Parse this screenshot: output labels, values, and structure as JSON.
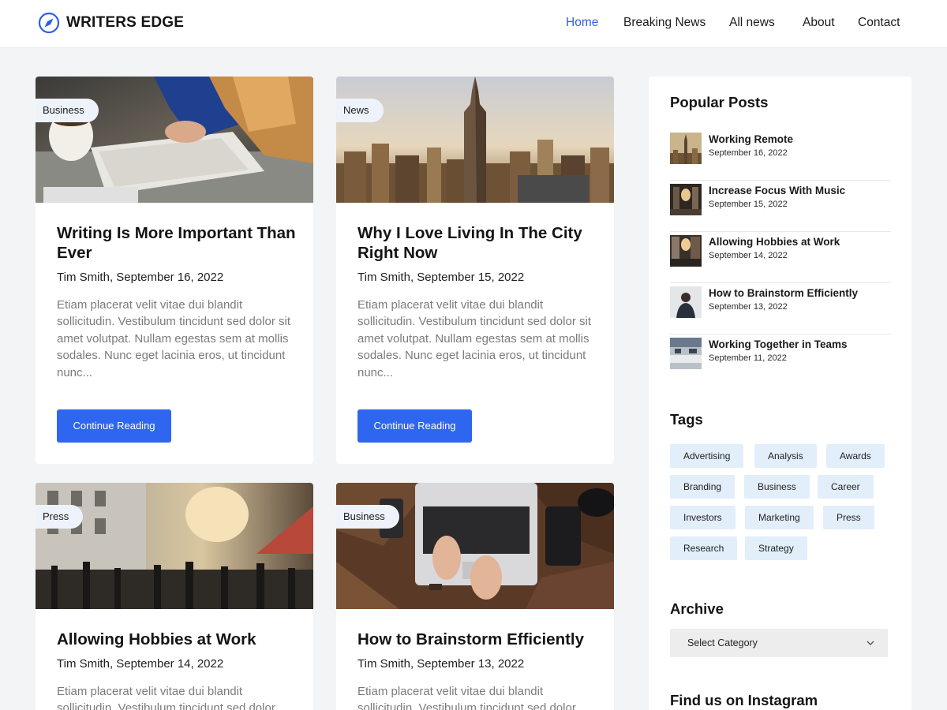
{
  "site": {
    "name": "WRITERS EDGE",
    "accent": "#2f66f0"
  },
  "nav": [
    {
      "label": "Home",
      "active": true
    },
    {
      "label": "Breaking News",
      "active": false
    },
    {
      "label": "All news",
      "active": false
    },
    {
      "label": "About",
      "active": false
    },
    {
      "label": "Contact",
      "active": false
    }
  ],
  "posts": [
    {
      "category": "Business",
      "title": "Writing Is More Important Than Ever",
      "meta": "Tim Smith, September 16, 2022",
      "excerpt": "Etiam placerat velit vitae dui blandit sollicitudin. Vestibulum tincidunt sed dolor sit amet volutpat. Nullam egestas sem at mollis sodales. Nunc eget lacinia eros, ut tincidunt nunc...",
      "button": "Continue Reading",
      "image": "desk-writing-photo"
    },
    {
      "category": "News",
      "title": "Why I Love Living In The City Right Now",
      "meta": "Tim Smith, September 15, 2022",
      "excerpt": "Etiam placerat velit vitae dui blandit sollicitudin. Vestibulum tincidunt sed dolor sit amet volutpat. Nullam egestas sem at mollis sodales. Nunc eget lacinia eros, ut tincidunt nunc...",
      "button": "Continue Reading",
      "image": "city-skyline-photo"
    },
    {
      "category": "Press",
      "title": "Allowing Hobbies at Work",
      "meta": "Tim Smith, September 14, 2022",
      "excerpt": "Etiam placerat velit vitae dui blandit sollicitudin. Vestibulum tincidunt sed dolor",
      "image": "street-crowd-photo"
    },
    {
      "category": "Business",
      "title": "How to Brainstorm Efficiently",
      "meta": "Tim Smith, September 13, 2022",
      "excerpt": "Etiam placerat velit vitae dui blandit sollicitudin. Vestibulum tincidunt sed dolor",
      "image": "laptop-typing-photo"
    }
  ],
  "sidebar": {
    "popular_heading": "Popular Posts",
    "popular": [
      {
        "title": "Working Remote",
        "date": "September 16, 2022"
      },
      {
        "title": "Increase Focus With Music",
        "date": "September 15, 2022"
      },
      {
        "title": "Allowing Hobbies at Work",
        "date": "September 14, 2022"
      },
      {
        "title": "How to Brainstorm Efficiently",
        "date": "September 13, 2022"
      },
      {
        "title": "Working Together in Teams",
        "date": "September 11, 2022"
      }
    ],
    "tags_heading": "Tags",
    "tags": [
      "Advertising",
      "Analysis",
      "Awards",
      "Branding",
      "Business",
      "Career",
      "Investors",
      "Marketing",
      "Press",
      "Research",
      "Strategy"
    ],
    "archive_heading": "Archive",
    "archive_select": "Select Category",
    "instagram_heading": "Find us on Instagram"
  }
}
